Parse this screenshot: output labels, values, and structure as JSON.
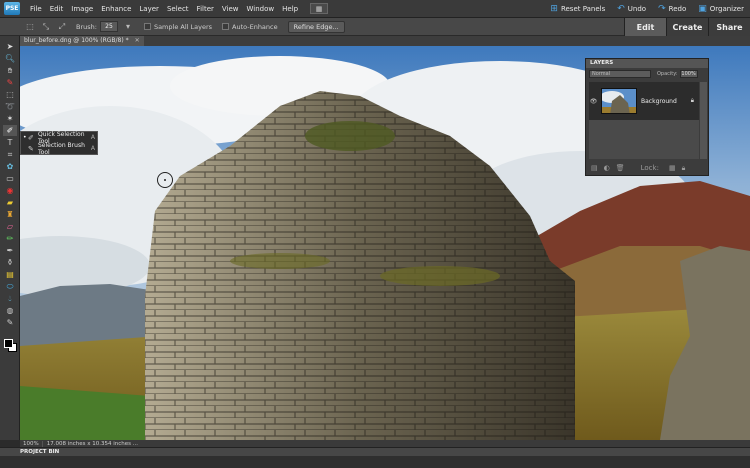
{
  "app": {
    "logo_text": "PSE"
  },
  "menu": {
    "items": [
      "File",
      "Edit",
      "Image",
      "Enhance",
      "Layer",
      "Select",
      "Filter",
      "View",
      "Window",
      "Help"
    ],
    "right": {
      "reset_panels": "Reset Panels",
      "undo": "Undo",
      "redo": "Redo",
      "organizer": "Organizer"
    }
  },
  "options": {
    "brush_label": "Brush:",
    "brush_size": "25",
    "sample_all_layers": "Sample All Layers",
    "auto_enhance": "Auto-Enhance",
    "refine_edge": "Refine Edge..."
  },
  "modes": {
    "edit": "Edit",
    "create": "Create",
    "share": "Share",
    "active": "Edit"
  },
  "document": {
    "tab_title": "blur_before.dng @ 100% (RGB/8) *",
    "zoom": "100%",
    "size": "17.008 inches x 10.354 inches ..."
  },
  "tool_flyout": {
    "items": [
      {
        "label": "Quick Selection Tool",
        "key": "A",
        "selected": true
      },
      {
        "label": "Selection Brush Tool",
        "key": "A",
        "selected": false
      }
    ]
  },
  "layers_panel": {
    "title": "LAYERS",
    "blend_mode": "Normal",
    "opacity_label": "Opacity:",
    "opacity": "100%",
    "lock_label": "Lock:",
    "layers": [
      {
        "name": "Background",
        "visible": true,
        "locked": true
      }
    ]
  },
  "project_bin": {
    "label": "PROJECT BIN"
  },
  "colors": {
    "accent": "#4fa3e0",
    "foreground": "#000000",
    "background": "#ffffff"
  }
}
